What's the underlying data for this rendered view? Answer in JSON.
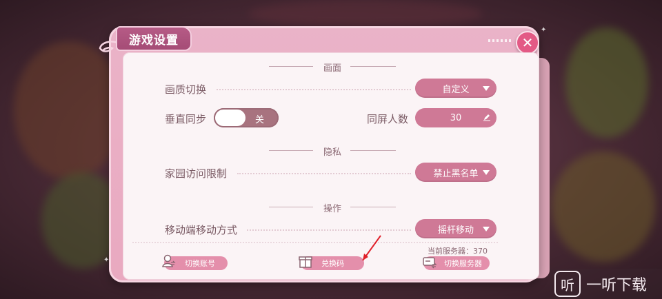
{
  "dialog": {
    "title": "游戏设置",
    "close_icon": "close-icon"
  },
  "sections": {
    "graphics": "画面",
    "privacy": "隐私",
    "controls": "操作"
  },
  "settings": {
    "quality_label": "画质切换",
    "quality_value": "自定义",
    "vsync_label": "垂直同步",
    "vsync_value": "关",
    "vsync_on": false,
    "players_label": "同屏人数",
    "players_value": "30",
    "home_label": "家园访问限制",
    "home_value": "禁止黑名单",
    "move_label": "移动端移动方式",
    "move_value": "摇杆移动"
  },
  "footer": {
    "switch_account": "切换账号",
    "redeem_code": "兑换码",
    "switch_server": "切换服务器",
    "current_server": "当前服务器：370"
  },
  "watermark": {
    "icon_glyph": "听",
    "text": "一听下载"
  },
  "colors": {
    "accent": "#cf7996",
    "title_tab": "#b65b86",
    "close": "#e35a85",
    "arrow": "#e0202a"
  }
}
